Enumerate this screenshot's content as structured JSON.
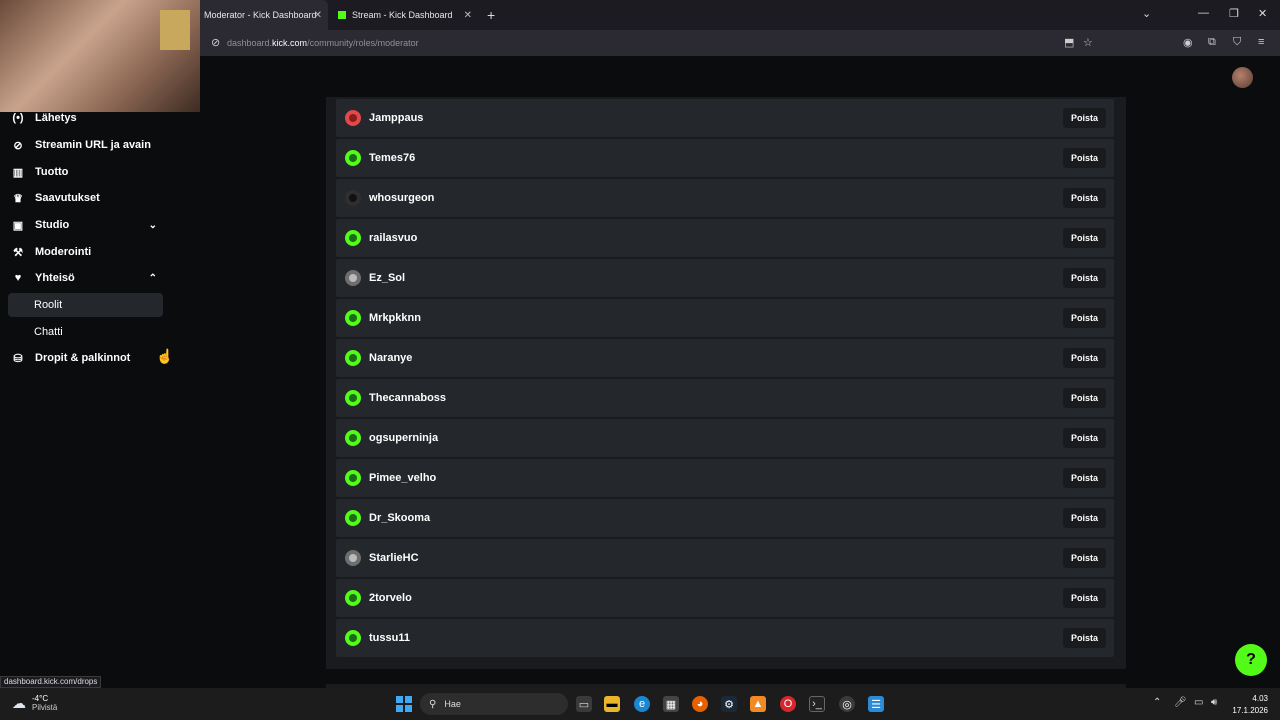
{
  "browser": {
    "tabs": [
      {
        "title": "Moderator - Kick Dashboard"
      },
      {
        "title": "Stream - Kick Dashboard"
      }
    ],
    "url_prefix": "dashboard.",
    "url_domain": "kick.com",
    "url_path": "/community/roles/moderator",
    "status_url": "dashboard.kick.com/drops"
  },
  "sidebar": {
    "items": [
      {
        "label": "Lähetys",
        "icon": "broadcast-icon"
      },
      {
        "label": "Streamin URL ja avain",
        "icon": "link-icon"
      },
      {
        "label": "Tuotto",
        "icon": "chart-icon"
      },
      {
        "label": "Saavutukset",
        "icon": "trophy-icon"
      },
      {
        "label": "Studio",
        "icon": "studio-icon"
      },
      {
        "label": "Moderointi",
        "icon": "wrench-icon"
      },
      {
        "label": "Yhteisö",
        "icon": "users-icon"
      },
      {
        "label": "Roolit"
      },
      {
        "label": "Chatti"
      },
      {
        "label": "Dropit & palkinnot",
        "icon": "gift-icon"
      }
    ]
  },
  "moderators": {
    "remove_label": "Poista",
    "rows": [
      {
        "name": "Jamppaus"
      },
      {
        "name": "Temes76"
      },
      {
        "name": "whosurgeon"
      },
      {
        "name": "railasvuo"
      },
      {
        "name": "Ez_Sol"
      },
      {
        "name": "Mrkpkknn"
      },
      {
        "name": "Naranye"
      },
      {
        "name": "Thecannaboss"
      },
      {
        "name": "ogsuperninja"
      },
      {
        "name": "Pimee_velho"
      },
      {
        "name": "Dr_Skooma"
      },
      {
        "name": "StarlieHC"
      },
      {
        "name": "2torvelo"
      },
      {
        "name": "tussu11"
      }
    ]
  },
  "taskbar": {
    "weather_temp": "-4°C",
    "weather_desc": "Pilvistä",
    "search_placeholder": "Hae",
    "time": "4.03",
    "date": "17.1.2026"
  },
  "colors": {
    "accent": "#53fc18",
    "panel": "#191b1f",
    "row": "#24272c"
  }
}
